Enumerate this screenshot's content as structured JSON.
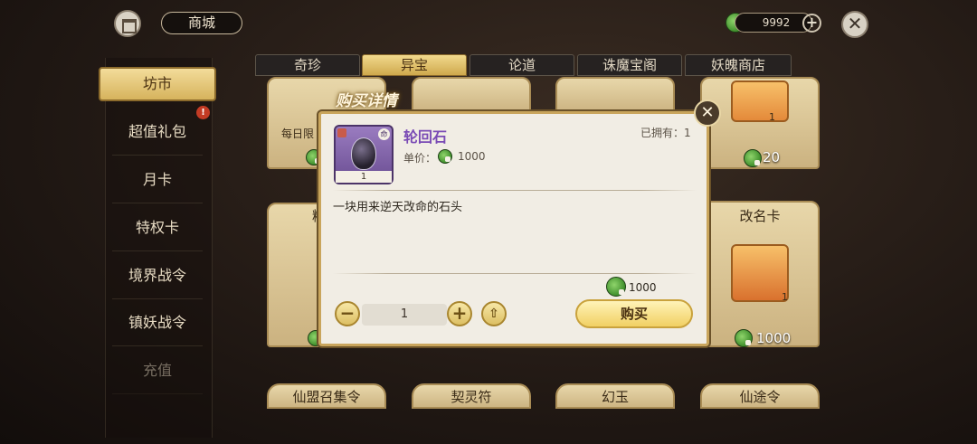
{
  "header": {
    "shop_title": "商城",
    "currency_amount": "9992"
  },
  "sidebar": {
    "items": [
      {
        "label": "坊市"
      },
      {
        "label": "超值礼包"
      },
      {
        "label": "月卡"
      },
      {
        "label": "特权卡"
      },
      {
        "label": "境界战令"
      },
      {
        "label": "镇妖战令"
      },
      {
        "label": "充值"
      }
    ],
    "badge": "!"
  },
  "tabs": [
    {
      "label": "奇珍"
    },
    {
      "label": "异宝"
    },
    {
      "label": "论道"
    },
    {
      "label": "诛魔宝阁"
    },
    {
      "label": "妖魄商店"
    }
  ],
  "grid": {
    "row1": {
      "card1_label": "每日限",
      "card4_qty": "1",
      "card4_price": "20"
    },
    "row2": {
      "card1_label": "精",
      "card4_title": "改名卡",
      "card4_qty": "1",
      "card4_price": "1000"
    },
    "row3": [
      {
        "label": "仙盟召集令"
      },
      {
        "label": "契灵符"
      },
      {
        "label": "幻玉"
      },
      {
        "label": "仙途令"
      }
    ]
  },
  "modal": {
    "title": "购买详情",
    "item_name": "轮回石",
    "owned_label": "已拥有：1",
    "unit_price_label": "单价：",
    "unit_price": "1000",
    "item_qty": "1",
    "fate_tag": "命",
    "description": "一块用来逆天改命的石头",
    "total": "1000",
    "quantity": "1",
    "buy_label": "购买"
  },
  "colors": {
    "accent_gold": "#d6b35d",
    "item_name": "#7a4bb5",
    "currency_green": "#3f8f2c"
  }
}
